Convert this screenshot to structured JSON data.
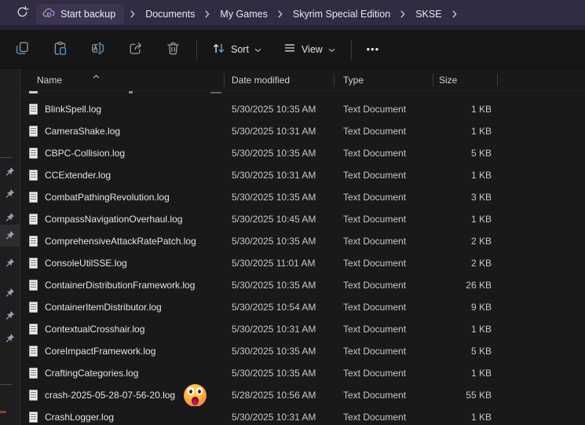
{
  "colors": {
    "topbar_bg": "#322c42",
    "topbar_edge": "#262138",
    "toolbar_bg": "#161616",
    "list_bg": "#191919",
    "strip_bg": "#1e1e1e",
    "accent_blue": "#5596c8",
    "backup_icon_purple": "#c07fe0",
    "breadcrumb_pill_bg": "#3b3550",
    "pin_gray": "#95a0b5",
    "red_indicator": "#a03434"
  },
  "titlebar": {
    "refresh_icon": "refresh-icon",
    "breadcrumb": {
      "backup_button": {
        "label": "Start backup",
        "icon": "cloud-backup-icon"
      },
      "items": [
        "Documents",
        "My Games",
        "Skyrim Special Edition",
        "SKSE"
      ]
    }
  },
  "toolbar": {
    "icon_buttons": [
      {
        "icon": "copy-icon"
      },
      {
        "icon": "paste-icon"
      },
      {
        "icon": "rename-icon"
      },
      {
        "icon": "share-icon"
      },
      {
        "icon": "delete-icon"
      }
    ],
    "sort": {
      "label": "Sort",
      "icon": "sort-icon"
    },
    "view": {
      "label": "View",
      "icon": "view-list-icon"
    },
    "more_label": "•••"
  },
  "list": {
    "columns": [
      "Name",
      "Date modified",
      "Type",
      "Size"
    ],
    "sort": {
      "column": "Name",
      "direction": "ascending"
    },
    "top_row_clipped": true,
    "files": [
      {
        "name": "BlinkSpell.log",
        "modified": "5/30/2025 10:35 AM",
        "type": "Text Document",
        "size": "1 KB"
      },
      {
        "name": "CameraShake.log",
        "modified": "5/30/2025 10:31 AM",
        "type": "Text Document",
        "size": "1 KB"
      },
      {
        "name": "CBPC-Collision.log",
        "modified": "5/30/2025 10:35 AM",
        "type": "Text Document",
        "size": "5 KB"
      },
      {
        "name": "CCExtender.log",
        "modified": "5/30/2025 10:31 AM",
        "type": "Text Document",
        "size": "1 KB"
      },
      {
        "name": "CombatPathingRevolution.log",
        "modified": "5/30/2025 10:35 AM",
        "type": "Text Document",
        "size": "3 KB"
      },
      {
        "name": "CompassNavigationOverhaul.log",
        "modified": "5/30/2025 10:45 AM",
        "type": "Text Document",
        "size": "1 KB"
      },
      {
        "name": "ComprehensiveAttackRatePatch.log",
        "modified": "5/30/2025 10:35 AM",
        "type": "Text Document",
        "size": "2 KB"
      },
      {
        "name": "ConsoleUtilSSE.log",
        "modified": "5/30/2025 11:01 AM",
        "type": "Text Document",
        "size": "2 KB"
      },
      {
        "name": "ContainerDistributionFramework.log",
        "modified": "5/30/2025 10:35 AM",
        "type": "Text Document",
        "size": "26 KB"
      },
      {
        "name": "ContainerItemDistributor.log",
        "modified": "5/30/2025 10:54 AM",
        "type": "Text Document",
        "size": "9 KB"
      },
      {
        "name": "ContextualCrosshair.log",
        "modified": "5/30/2025 10:31 AM",
        "type": "Text Document",
        "size": "1 KB"
      },
      {
        "name": "CoreImpactFramework.log",
        "modified": "5/30/2025 10:35 AM",
        "type": "Text Document",
        "size": "5 KB"
      },
      {
        "name": "CraftingCategories.log",
        "modified": "5/30/2025 10:35 AM",
        "type": "Text Document",
        "size": "1 KB"
      },
      {
        "name": "crash-2025-05-28-07-56-20.log",
        "modified": "5/28/2025 10:56 AM",
        "type": "Text Document",
        "size": "55 KB",
        "emoji_sticker": "astonished-face"
      },
      {
        "name": "CrashLogger.log",
        "modified": "5/30/2025 10:31 AM",
        "type": "Text Document",
        "size": "1 KB"
      }
    ]
  },
  "nav_strip": {
    "pin_offsets": [
      131,
      159,
      189,
      212,
      247,
      285,
      314,
      343
    ],
    "highlighted_index": 3
  }
}
